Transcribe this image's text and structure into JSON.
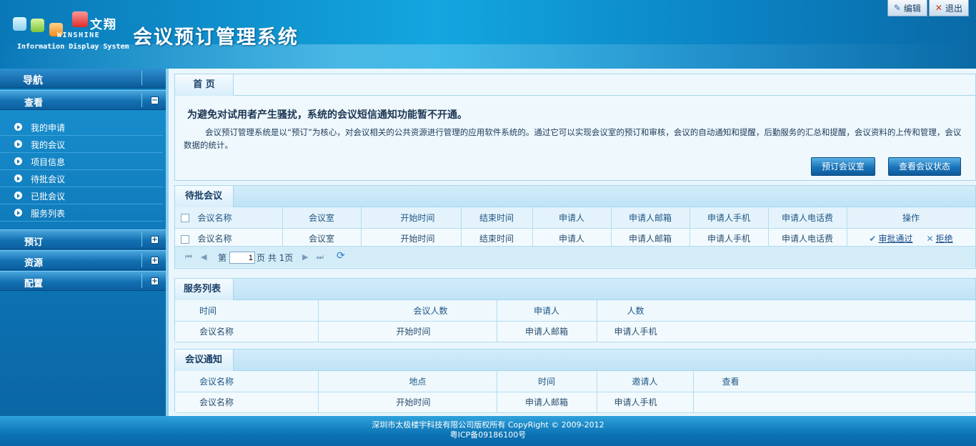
{
  "header": {
    "logo_cn": "文翔",
    "logo_en": "WINSHINE",
    "logo_tagline": "Information Display System",
    "app_title": "会议预订管理系统",
    "edit_label": "编辑",
    "logout_label": "退出"
  },
  "sidebar": {
    "nav_title": "导航",
    "sections": [
      {
        "label": "查看",
        "toggle": "−"
      },
      {
        "label": "预订",
        "toggle": "+"
      },
      {
        "label": "资源",
        "toggle": "+"
      },
      {
        "label": "配置",
        "toggle": "+"
      }
    ],
    "items": [
      "我的申请",
      "我的会议",
      "项目信息",
      "待批会议",
      "已批会议",
      "服务列表"
    ]
  },
  "home": {
    "tab": "首 页",
    "notice": "为避免对试用者产生骚扰，系统的会议短信通知功能暂不开通。",
    "description": "会议预订管理系统是以“预订”为核心，对会议相关的公共资源进行管理的应用软件系统的。通过它可以实现会议室的预订和审核，会议的自动通知和提醒，后勤服务的汇总和提醒，会议资料的上传和管理，会议数据的统计。",
    "book_button": "预订会议室",
    "status_button": "查看会议状态"
  },
  "pending": {
    "tab": "待批会议",
    "headers": [
      "会议名称",
      "会议室",
      "开始时间",
      "结束时间",
      "申请人",
      "申请人邮箱",
      "申请人手机",
      "申请人电话费",
      "操作"
    ],
    "rows": [
      [
        "会议名称",
        "会议室",
        "开始时间",
        "结束时间",
        "申请人",
        "申请人邮箱",
        "申请人手机",
        "申请人电话费"
      ]
    ],
    "approve": "审批通过",
    "reject": "拒绝",
    "pager": {
      "prefix": "第",
      "page": "1",
      "suffix": "页 共 1页"
    }
  },
  "services": {
    "tab": "服务列表",
    "headers": [
      "时间",
      "会议人数",
      "申请人",
      "人数"
    ],
    "rows": [
      [
        "会议名称",
        "开始时间",
        "申请人邮箱",
        "申请人手机"
      ]
    ]
  },
  "notices": {
    "tab": "会议通知",
    "headers": [
      "会议名称",
      "地点",
      "时间",
      "邀请人",
      "查看"
    ],
    "rows": [
      [
        "会议名称",
        "开始时间",
        "申请人邮箱",
        "申请人手机",
        ""
      ]
    ]
  },
  "footer": {
    "line1": "深圳市太极楼宇科技有限公司版权所有 CopyRight © 2009-2012",
    "line2": "粤ICP备09186100号"
  },
  "colors": {
    "header": "#13a6df",
    "sidebar": "#0d73b4",
    "panel_bg": "#eef8fd",
    "button": "#1a73b8"
  }
}
